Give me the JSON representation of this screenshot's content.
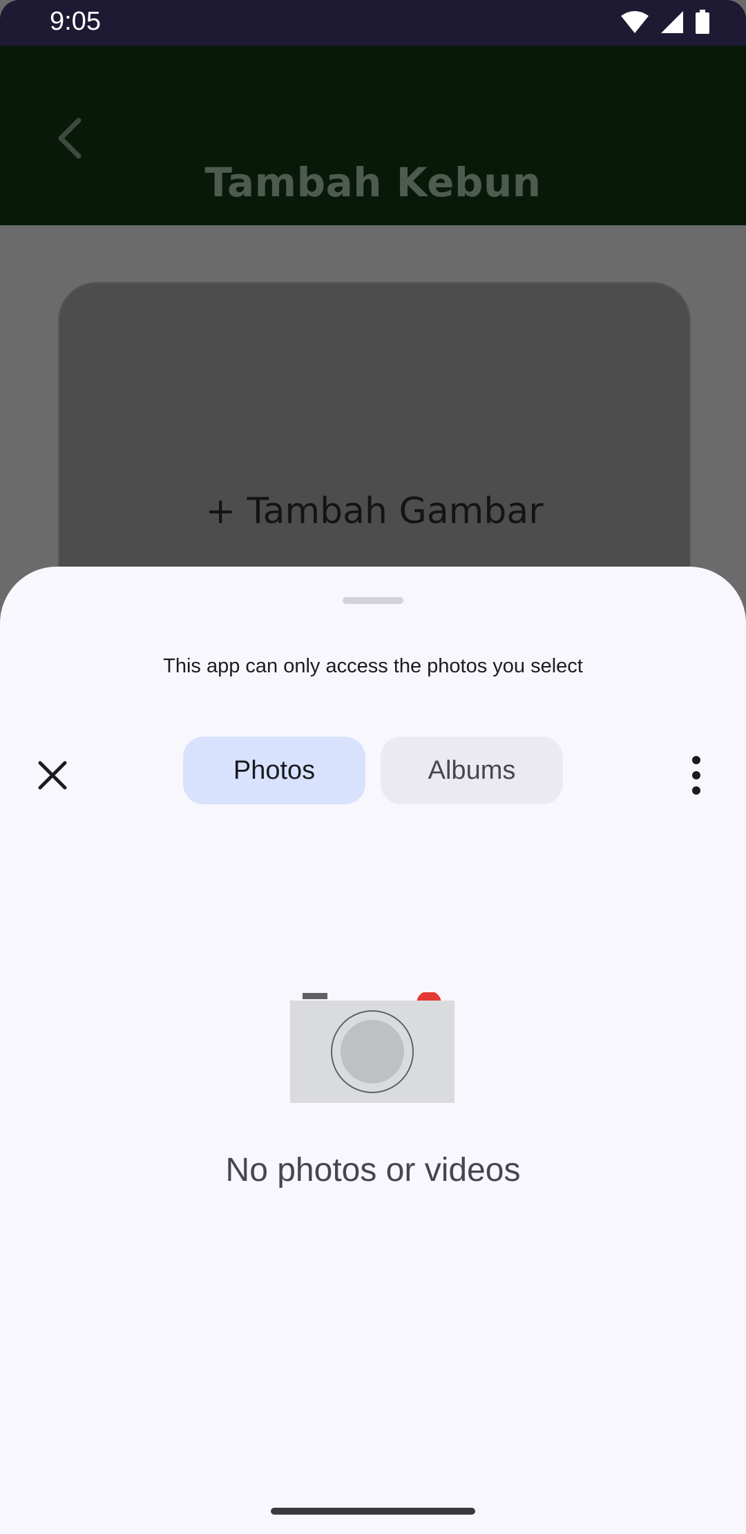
{
  "status_bar": {
    "time": "9:05",
    "icons": [
      "wifi-icon",
      "signal-icon",
      "battery-icon"
    ]
  },
  "app_bar": {
    "title": "Tambah Kebun",
    "back_icon": "chevron-left-icon"
  },
  "form": {
    "add_image_label": "+ Tambah Gambar"
  },
  "photo_picker": {
    "info_text": "This app can only access the photos you select",
    "close_icon": "close-icon",
    "tabs": [
      {
        "label": "Photos",
        "selected": true
      },
      {
        "label": "Albums",
        "selected": false
      }
    ],
    "more_icon": "more-vertical-icon",
    "empty_state": {
      "icon": "camera-icon",
      "message": "No photos or videos"
    }
  },
  "colors": {
    "status_bar_bg": "#1e1a33",
    "app_bar_bg": "#08190a",
    "scrim": "#6b6b6b",
    "sheet_bg": "#f8f7fd",
    "tab_selected_bg": "#d8e2fc",
    "tab_unselected_bg": "#ebeaf1",
    "camera_accent": "#e53935"
  }
}
